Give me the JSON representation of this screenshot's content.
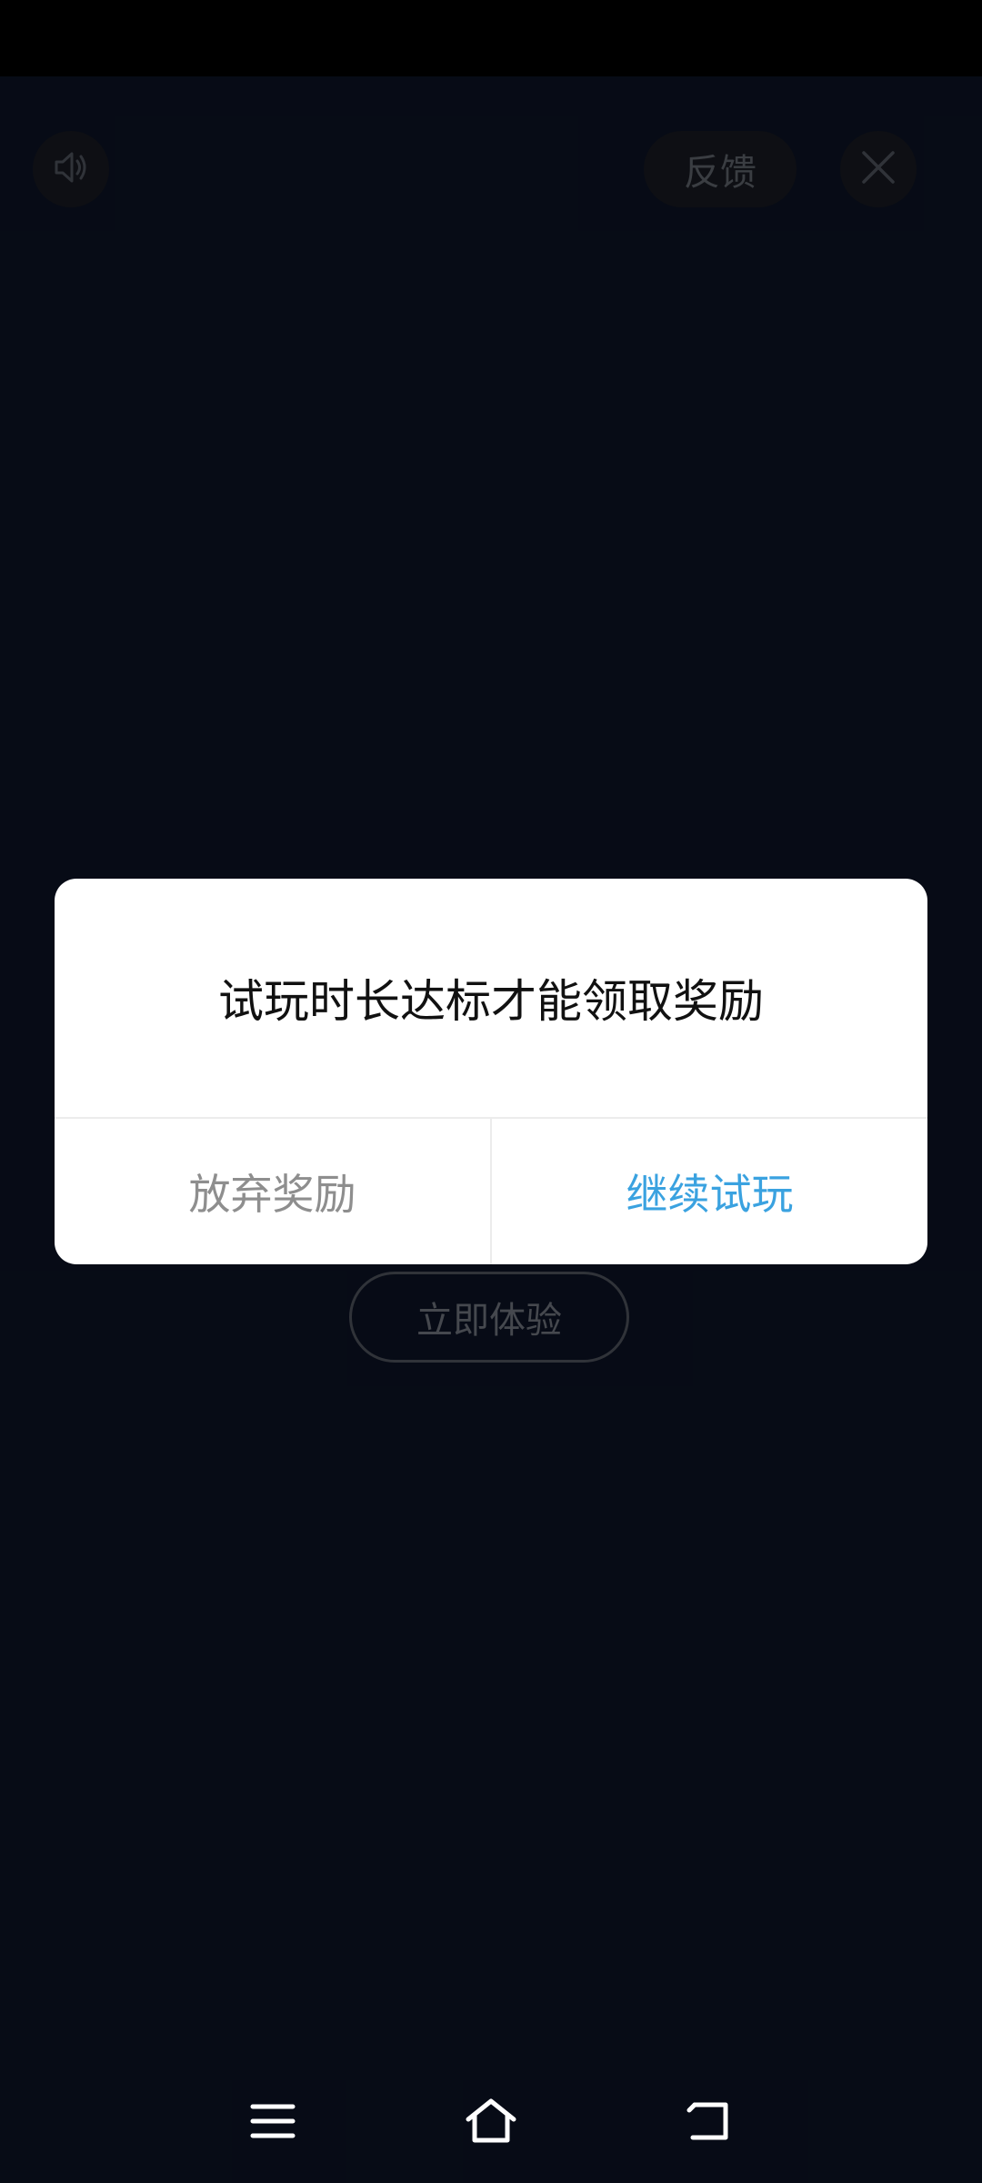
{
  "status_bar": {},
  "toolbar": {
    "feedback_label": "反馈",
    "sound_icon": "speaker-icon",
    "close_icon": "close-icon"
  },
  "content": {
    "cta_label": "立即体验"
  },
  "dialog": {
    "message": "试玩时长达标才能领取奖励",
    "abandon_label": "放弃奖励",
    "continue_label": "继续试玩"
  },
  "nav_bar": {
    "menu_icon": "menu-icon",
    "home_icon": "home-icon",
    "back_icon": "back-icon"
  },
  "colors": {
    "background": "#0b1222",
    "dialog_background": "#ffffff",
    "accent": "#3aa2e0",
    "secondary_text": "#8e8e8e"
  }
}
